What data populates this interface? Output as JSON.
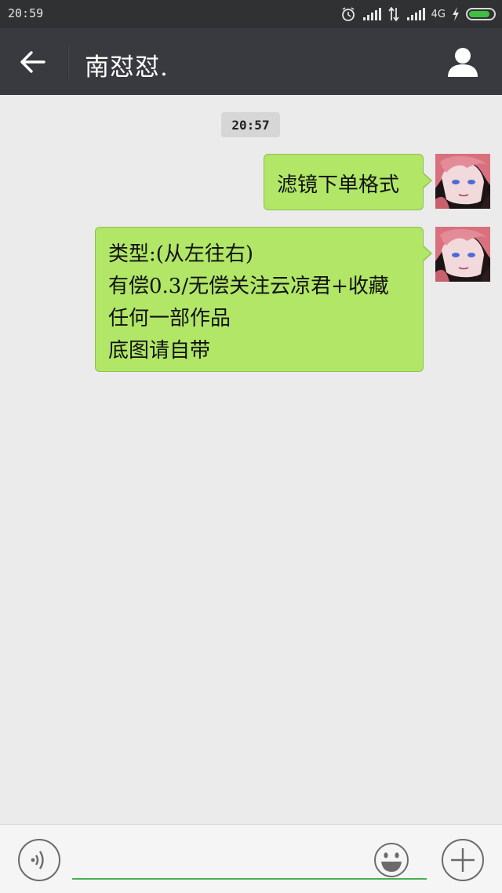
{
  "status_bar": {
    "time": "20:59",
    "network": "4G",
    "icons": [
      "alarm-icon",
      "signal-icon",
      "data-transfer-icon",
      "signal-icon",
      "charging-icon",
      "battery-icon"
    ],
    "battery_level": 0.85
  },
  "header": {
    "back_icon": "back-arrow-icon",
    "title": "南怼怼.",
    "profile_icon": "person-icon"
  },
  "chat": {
    "timestamp": "20:57",
    "messages": [
      {
        "sender": "self",
        "lines": [
          "滤镜下单格式"
        ]
      },
      {
        "sender": "self",
        "lines": [
          "类型:(从左往右)",
          "有偿0.3/无偿关注云凉君+收藏",
          "任何一部作品",
          "底图请自带"
        ]
      }
    ]
  },
  "input_bar": {
    "voice_icon": "voice-icon",
    "input_value": "",
    "emoji_icon": "emoji-icon",
    "plus_icon": "plus-icon"
  },
  "colors": {
    "status_bar_bg": "#2f3133",
    "header_bg": "#393a3f",
    "chat_bg": "#ebebeb",
    "bubble_green": "#b1e667",
    "input_underline": "#4caf50"
  }
}
